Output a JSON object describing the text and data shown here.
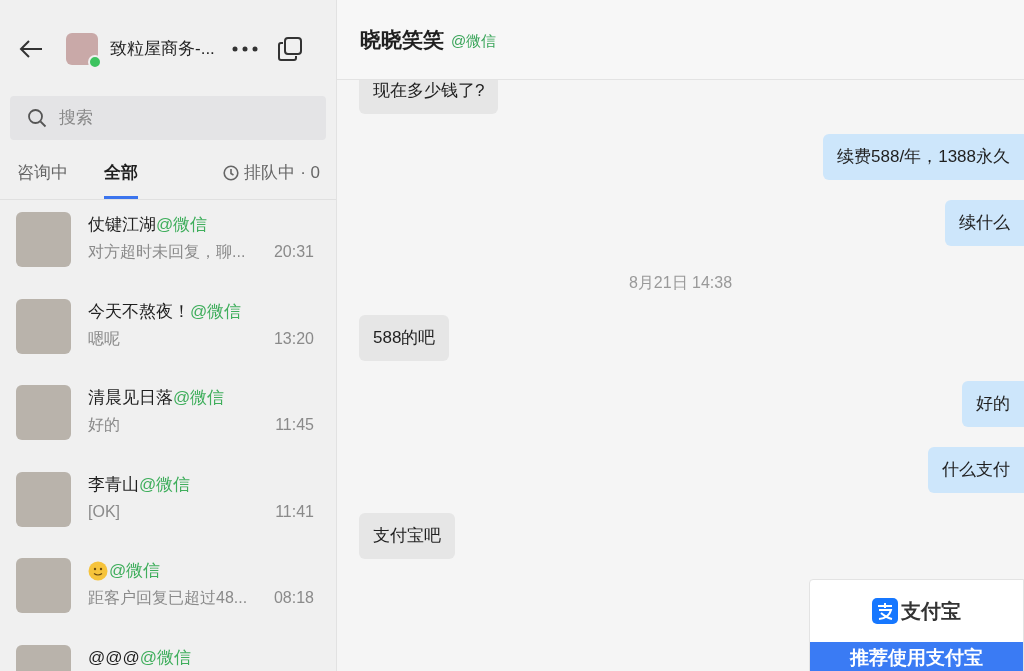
{
  "account": {
    "name": "致粒屋商务-...",
    "online": true
  },
  "search": {
    "placeholder": "搜索"
  },
  "tabs": [
    {
      "label": "咨询中",
      "selected": false
    },
    {
      "label": "全部",
      "selected": true
    }
  ],
  "queue": {
    "label": "排队中 · 0"
  },
  "conversations": [
    {
      "kind": "text",
      "name": "仗键江湖",
      "channel": "@微信",
      "preview": "对方超时未回复，聊...",
      "time": "20:31"
    },
    {
      "kind": "text",
      "name": "今天不熬夜！",
      "channel": "@微信",
      "preview": "嗯呢",
      "time": "13:20"
    },
    {
      "kind": "text",
      "name": "清晨见日落",
      "channel": "@微信",
      "preview": "好的",
      "time": "11:45"
    },
    {
      "kind": "text",
      "name": "李青山",
      "channel": "@微信",
      "preview": "[OK]",
      "time": "11:41"
    },
    {
      "kind": "emoji",
      "channel": "@微信",
      "preview": "距客户回复已超过48...",
      "time": "08:18"
    },
    {
      "kind": "text",
      "name": "@@@",
      "channel": "@微信"
    }
  ],
  "chat": {
    "title": "晓晓笑笑",
    "channel": "@微信",
    "messages": [
      {
        "kind": "in",
        "text": "现在多少钱了?"
      },
      {
        "kind": "out",
        "text": "续费588/年，1388永久"
      },
      {
        "kind": "out",
        "text": "续什么"
      },
      {
        "kind": "time",
        "text": "8月21日 14:38"
      },
      {
        "kind": "in",
        "text": "588的吧"
      },
      {
        "kind": "out",
        "text": "好的"
      },
      {
        "kind": "out",
        "text": "什么支付"
      },
      {
        "kind": "in",
        "text": "支付宝吧"
      },
      {
        "kind": "card",
        "brand": "支付宝",
        "button": "推荐使用支付宝"
      }
    ]
  }
}
